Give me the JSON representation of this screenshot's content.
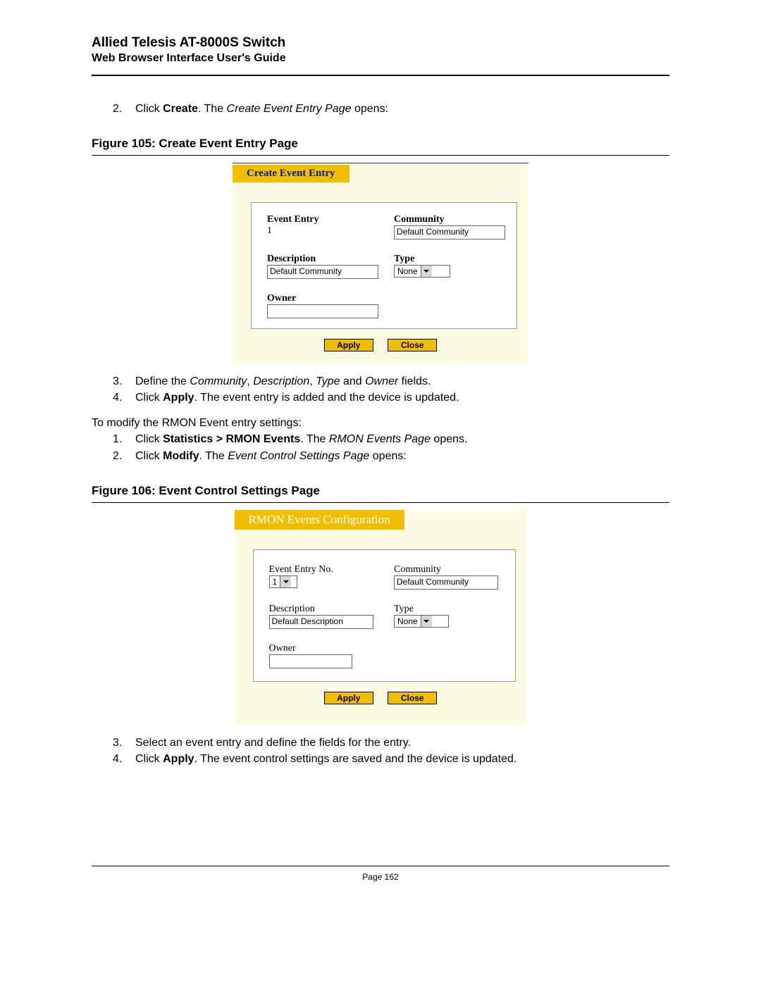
{
  "header": {
    "title": "Allied Telesis AT-8000S Switch",
    "subtitle": "Web Browser Interface User's Guide"
  },
  "intro": {
    "step2_num": "2.",
    "step2_pre": "Click ",
    "step2_bold": "Create",
    "step2_post1": ". The ",
    "step2_italic": "Create Event Entry Page",
    "step2_post2": " opens:"
  },
  "fig105_label": "Figure 105: Create Event Entry Page",
  "fig105": {
    "tab": "Create Event Entry",
    "labels": {
      "event_entry": "Event Entry",
      "community": "Community",
      "description": "Description",
      "type": "Type",
      "owner": "Owner"
    },
    "values": {
      "event_entry": "1",
      "community": "Default Community",
      "description": "Default Community",
      "type": "None",
      "owner": ""
    },
    "buttons": {
      "apply": "Apply",
      "close": "Close"
    }
  },
  "after105": {
    "s3_num": "3.",
    "s3_a": "Define the ",
    "s3_i1": "Community",
    "s3_b": ", ",
    "s3_i2": "Description",
    "s3_c": ", ",
    "s3_i3": "Type",
    "s3_d": " and ",
    "s3_i4": "Owner",
    "s3_e": " fields.",
    "s4_num": "4.",
    "s4_a": "Click ",
    "s4_bold": "Apply",
    "s4_b": ". The event entry is added and the device is updated.",
    "modify_intro": "To modify the RMON Event entry settings:",
    "m1_num": "1.",
    "m1_a": "Click ",
    "m1_bold": "Statistics > RMON Events",
    "m1_b": ". The ",
    "m1_i": "RMON Events Page",
    "m1_c": " opens.",
    "m2_num": "2.",
    "m2_a": "Click ",
    "m2_bold": "Modify",
    "m2_b": ". The ",
    "m2_i": "Event Control Settings Page",
    "m2_c": " opens:"
  },
  "fig106_label": "Figure 106: Event Control Settings Page",
  "fig106": {
    "tab": "RMON Events Configuration",
    "labels": {
      "event_entry_no": "Event Entry No.",
      "community": "Community",
      "description": "Description",
      "type": "Type",
      "owner": "Owner"
    },
    "values": {
      "event_entry_no": "1",
      "community": "Default Community",
      "description": "Default Description",
      "type": "None",
      "owner": ""
    },
    "buttons": {
      "apply": "Apply",
      "close": "Close"
    }
  },
  "after106": {
    "s3_num": "3.",
    "s3_text": "Select an event entry and define the fields for the entry.",
    "s4_num": "4.",
    "s4_a": "Click ",
    "s4_bold": "Apply",
    "s4_b": ". The event control settings are saved and the device is updated."
  },
  "footer": {
    "page": "Page 162"
  }
}
